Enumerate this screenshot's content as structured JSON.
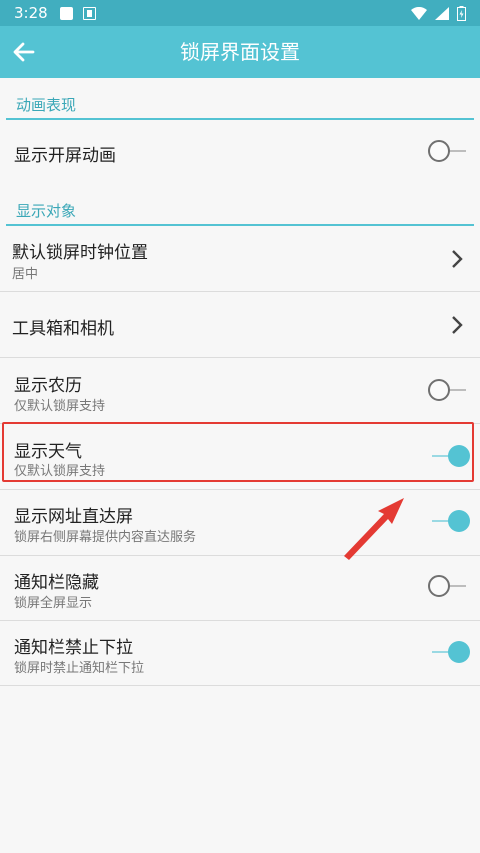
{
  "status_bar": {
    "time": "3:28"
  },
  "app_bar": {
    "title": "锁屏界面设置"
  },
  "sections": [
    {
      "header": "动画表现",
      "rows": [
        {
          "title": "显示开屏动画",
          "control": "toggle",
          "state": "off"
        }
      ]
    },
    {
      "header": "显示对象",
      "rows": [
        {
          "title": "默认锁屏时钟位置",
          "subtitle": "居中",
          "control": "chevron"
        },
        {
          "title": "工具箱和相机",
          "control": "chevron"
        },
        {
          "title": "显示农历",
          "subtitle": "仅默认锁屏支持",
          "control": "toggle",
          "state": "off"
        },
        {
          "title": "显示天气",
          "subtitle": "仅默认锁屏支持",
          "control": "toggle",
          "state": "on"
        },
        {
          "title": "显示网址直达屏",
          "subtitle": "锁屏右侧屏幕提供内容直达服务",
          "control": "toggle",
          "state": "on"
        },
        {
          "title": "通知栏隐藏",
          "subtitle": "锁屏全屏显示",
          "control": "toggle",
          "state": "off"
        },
        {
          "title": "通知栏禁止下拉",
          "subtitle": "锁屏时禁止通知栏下拉",
          "control": "toggle",
          "state": "on"
        }
      ]
    }
  ],
  "colors": {
    "accent": "#54c3d3",
    "status_bar": "#41aebf",
    "highlight": "#e43a33"
  }
}
